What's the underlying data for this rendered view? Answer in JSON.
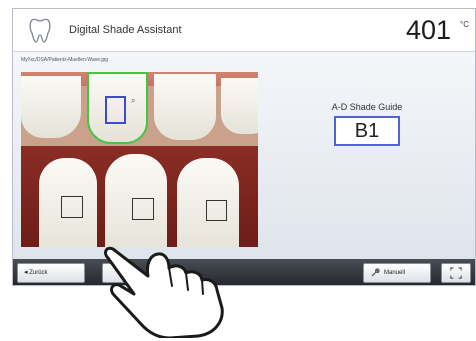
{
  "header": {
    "title": "Digital Shade Assistant",
    "temperature": "401",
    "temperature_unit": "°C",
    "icon": "tooth-icon"
  },
  "image": {
    "file_path": "My!\\xc/DSA/Patients-Muellen-Wave.jpg",
    "zoom_icon": "zoom-icon"
  },
  "shade_guide": {
    "label": "A-D Shade Guide",
    "value": "B1"
  },
  "toolbar": {
    "back_label": "Zurück",
    "back_icon": "chevron-left-icon",
    "manual_label": "Manuell",
    "manual_icon": "wrench-icon",
    "fullscreen_icon": "fullscreen-icon"
  },
  "colors": {
    "selection_upper": "#3b4ec9",
    "tooth_outline": "#45c443",
    "toolbar": "#2a2d33"
  }
}
